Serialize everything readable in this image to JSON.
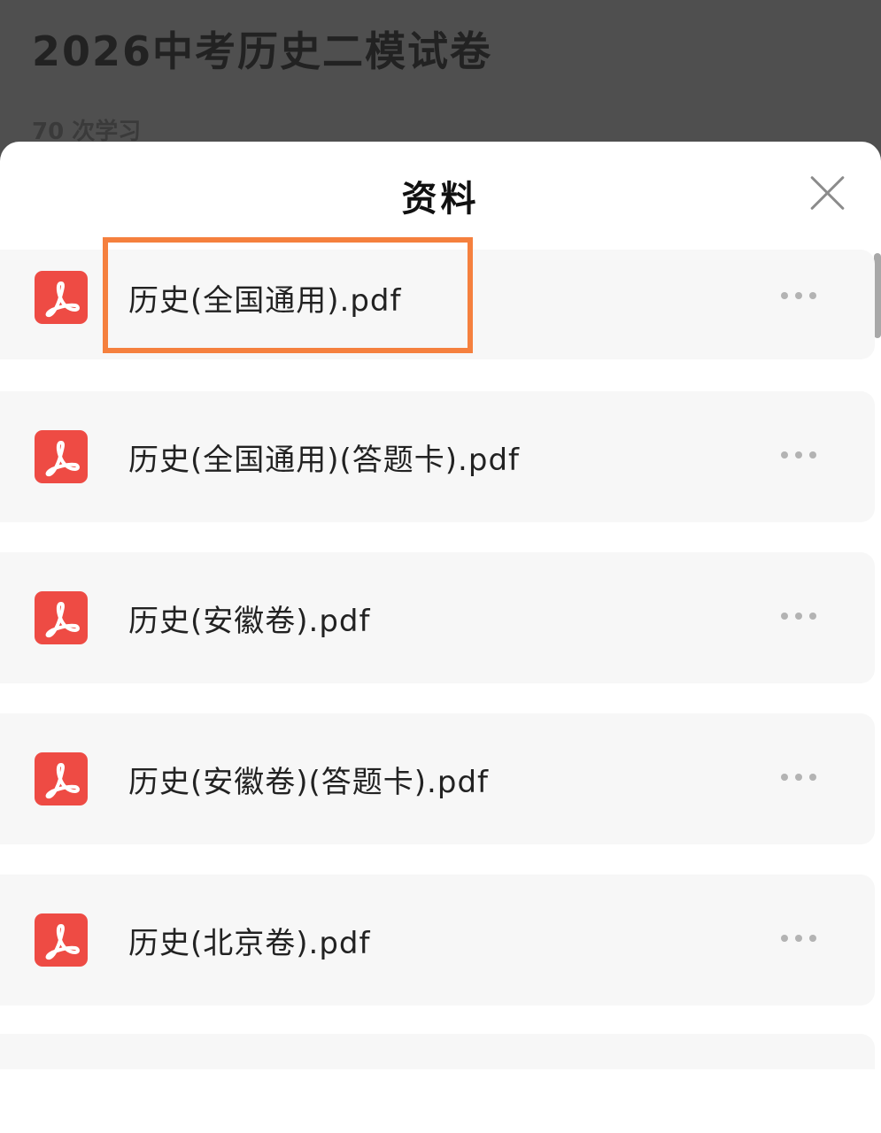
{
  "background_page": {
    "title": "2026中考历史二模试卷",
    "study_count": "70 次学习"
  },
  "sheet": {
    "title": "资料",
    "close_icon": "close-icon"
  },
  "files": [
    {
      "name": "历史(全国通用).pdf",
      "icon": "pdf-icon",
      "highlighted": true
    },
    {
      "name": "历史(全国通用)(答题卡).pdf",
      "icon": "pdf-icon",
      "highlighted": false
    },
    {
      "name": "历史(安徽卷).pdf",
      "icon": "pdf-icon",
      "highlighted": false
    },
    {
      "name": "历史(安徽卷)(答题卡).pdf",
      "icon": "pdf-icon",
      "highlighted": false
    },
    {
      "name": "历史(北京卷).pdf",
      "icon": "pdf-icon",
      "highlighted": false
    }
  ],
  "colors": {
    "pdf_icon": "#ee4b44",
    "highlight": "#f5803e",
    "sheet_background": "#ffffff",
    "backdrop": "#4f4f4f"
  }
}
